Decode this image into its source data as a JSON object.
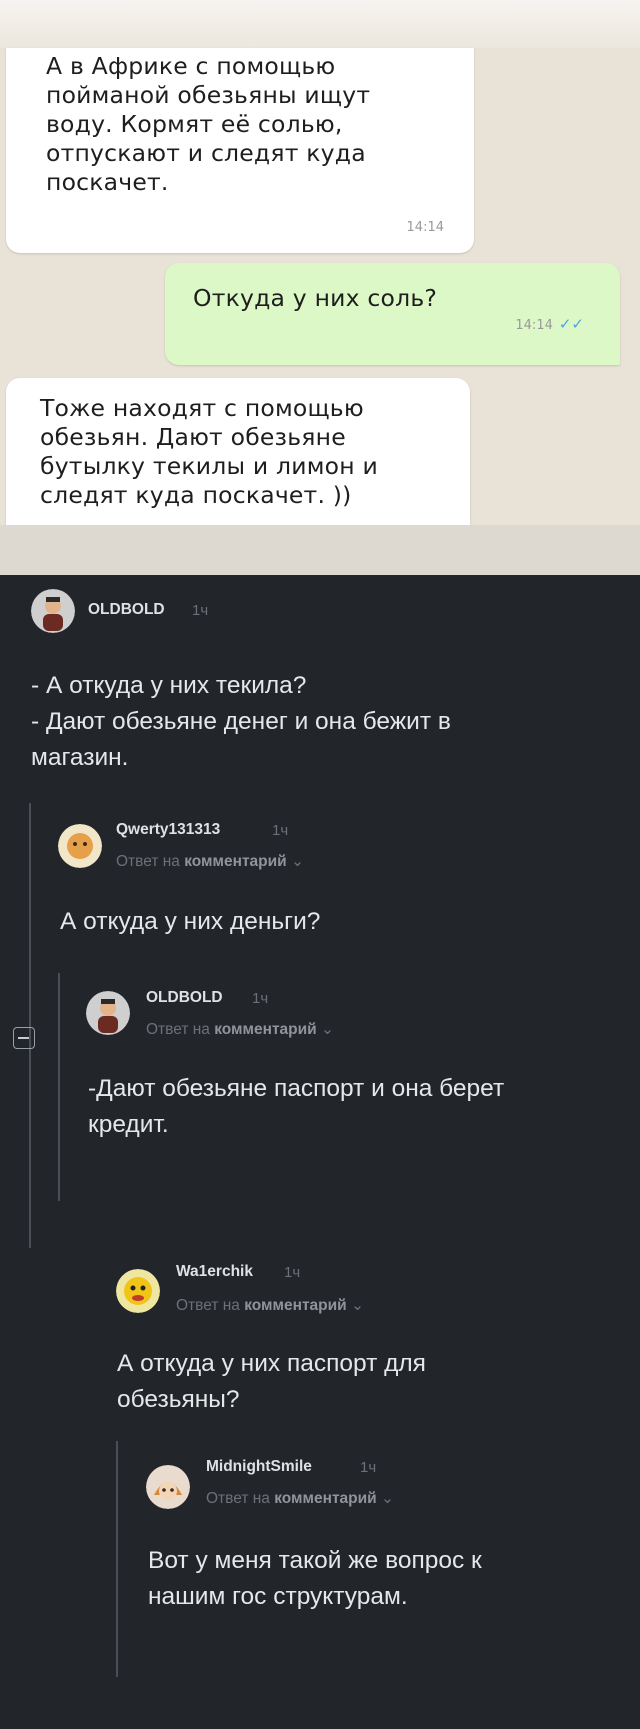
{
  "chat": {
    "messages": [
      {
        "text": "А в Африке с помощью\nпойманой обезьяны ищут\nводу. Кормят её солью,\nотпускают и следят куда\nпоскачет.",
        "time": "14:14",
        "side": "incoming"
      },
      {
        "text": "Откуда у них соль?",
        "time": "14:14",
        "side": "outgoing",
        "status": "read"
      },
      {
        "text": "Тоже находят с помощью\nобезьян. Дают обезьяне\nбутылку текилы и лимон и\nследят куда поскачет. ))",
        "side": "incoming"
      }
    ]
  },
  "comments": [
    {
      "user": "OLDBOLD",
      "time": "1ч",
      "text": "- А откуда у них текила?\n- Дают обезьяне денег и она бежит в\nмагазин."
    },
    {
      "user": "Qwerty131313",
      "time": "1ч",
      "reply_prefix": "Ответ на",
      "reply_target": "комментарий",
      "text": "А откуда у них деньги?"
    },
    {
      "user": "OLDBOLD",
      "time": "1ч",
      "reply_prefix": "Ответ на",
      "reply_target": "комментарий",
      "text": "-Дают обезьяне паспорт и она берет\nкредит."
    },
    {
      "user": "Wa1erchik",
      "time": "1ч",
      "reply_prefix": "Ответ на",
      "reply_target": "комментарий",
      "text": "А откуда у них паспорт для\nобезьяны?"
    },
    {
      "user": "MidnightSmile",
      "time": "1ч",
      "reply_prefix": "Ответ на",
      "reply_target": "комментарий",
      "text": "Вот у меня такой же вопрос к\nнашим гос структурам."
    }
  ],
  "icons": {
    "collapse": "minus-box-icon",
    "chevron": "chevron-down-icon",
    "read_ticks": "double-check-icon"
  },
  "colors": {
    "chat_bg": "#e9e3d7",
    "outgoing_bubble": "#dcf8c6",
    "comments_bg": "#22262b",
    "read_ticks": "#4fa3e0"
  }
}
